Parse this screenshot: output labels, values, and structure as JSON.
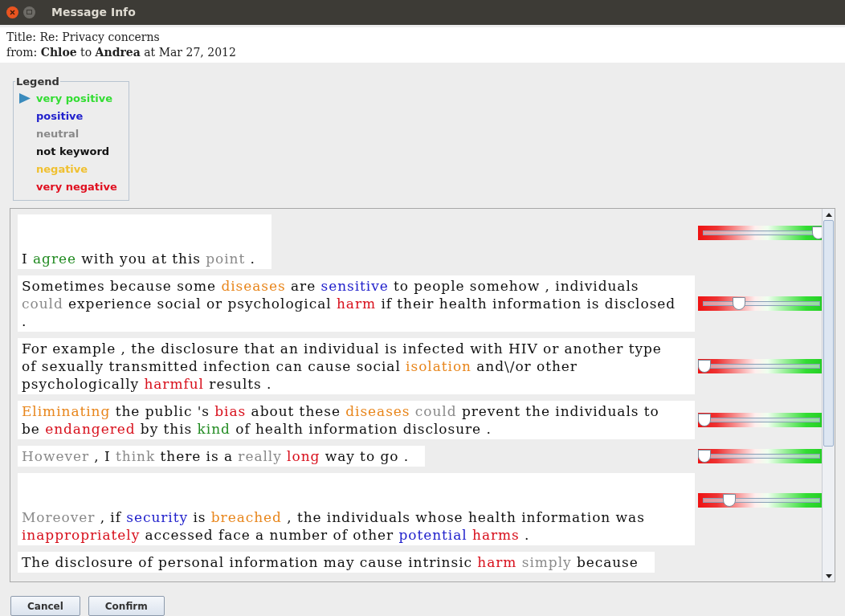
{
  "window": {
    "title": "Message Info"
  },
  "header": {
    "title_label": "Title:",
    "title": "Re: Privacy concerns",
    "from_label": "from:",
    "sender": "Chloe",
    "to_label": "to",
    "recipient": "Andrea",
    "at_label": "at",
    "date": "Mar 27, 2012"
  },
  "legend": {
    "title": "Legend",
    "items": [
      {
        "label": "very positive",
        "kind": "very_positive",
        "selected": true
      },
      {
        "label": "positive",
        "kind": "positive",
        "selected": false
      },
      {
        "label": "neutral",
        "kind": "neutral",
        "selected": false
      },
      {
        "label": "not keyword",
        "kind": "none",
        "selected": false
      },
      {
        "label": "negative",
        "kind": "negative",
        "selected": false
      },
      {
        "label": "very negative",
        "kind": "very_negative",
        "selected": false
      }
    ]
  },
  "sentences": [
    {
      "blank_line": true,
      "level": 1,
      "words": [
        {
          "text": "I",
          "kind": "none"
        },
        {
          "text": "agree",
          "kind": "very_positive"
        },
        {
          "text": "with you at this",
          "kind": "none"
        },
        {
          "text": "point",
          "kind": "neutral"
        },
        {
          "text": ".",
          "kind": "none"
        }
      ]
    },
    {
      "blank_line": false,
      "level": 0.3,
      "words": [
        {
          "text": "Sometimes because some",
          "kind": "none"
        },
        {
          "text": "diseases",
          "kind": "negative"
        },
        {
          "text": "are",
          "kind": "none"
        },
        {
          "text": "sensitive",
          "kind": "positive"
        },
        {
          "text": "to people somehow , individuals",
          "kind": "none"
        },
        {
          "text": "could",
          "kind": "neutral"
        },
        {
          "text": "experience social or psychological",
          "kind": "none"
        },
        {
          "text": "harm",
          "kind": "very_negative"
        },
        {
          "text": "if their health information is disclosed .",
          "kind": "none"
        }
      ]
    },
    {
      "blank_line": false,
      "level": 0,
      "words": [
        {
          "text": "For example , the disclosure that an individual is infected with HIV or another type of sexually transmitted infection can cause social",
          "kind": "none"
        },
        {
          "text": "isolation",
          "kind": "negative"
        },
        {
          "text": "and\\/or other psychologically",
          "kind": "none"
        },
        {
          "text": "harmful",
          "kind": "very_negative"
        },
        {
          "text": "results .",
          "kind": "none"
        }
      ]
    },
    {
      "blank_line": false,
      "level": 0,
      "words": [
        {
          "text": "Eliminating",
          "kind": "negative"
        },
        {
          "text": "the public 's",
          "kind": "none"
        },
        {
          "text": "bias",
          "kind": "very_negative"
        },
        {
          "text": "about these",
          "kind": "none"
        },
        {
          "text": "diseases",
          "kind": "negative"
        },
        {
          "text": "could",
          "kind": "neutral"
        },
        {
          "text": "prevent the individuals to be",
          "kind": "none"
        },
        {
          "text": "endangered",
          "kind": "very_negative"
        },
        {
          "text": "by this",
          "kind": "none"
        },
        {
          "text": "kind",
          "kind": "very_positive"
        },
        {
          "text": "of health information disclosure .",
          "kind": "none"
        }
      ]
    },
    {
      "blank_line": false,
      "level": 0,
      "words": [
        {
          "text": "However",
          "kind": "neutral"
        },
        {
          "text": ", I",
          "kind": "none"
        },
        {
          "text": "think",
          "kind": "neutral"
        },
        {
          "text": "there is a",
          "kind": "none"
        },
        {
          "text": "really",
          "kind": "neutral"
        },
        {
          "text": "long",
          "kind": "very_negative"
        },
        {
          "text": "way to go .",
          "kind": "none"
        }
      ]
    },
    {
      "blank_line": true,
      "level": 0.22,
      "words": [
        {
          "text": "Moreover",
          "kind": "neutral"
        },
        {
          "text": ", if",
          "kind": "none"
        },
        {
          "text": "security",
          "kind": "positive"
        },
        {
          "text": "is",
          "kind": "none"
        },
        {
          "text": "breached",
          "kind": "negative"
        },
        {
          "text": ", the individuals whose health information was",
          "kind": "none"
        },
        {
          "text": "inappropriately",
          "kind": "very_negative"
        },
        {
          "text": "accessed face a number of other",
          "kind": "none"
        },
        {
          "text": "potential",
          "kind": "positive"
        },
        {
          "text": "harms",
          "kind": "very_negative"
        },
        {
          "text": ".",
          "kind": "none"
        }
      ]
    },
    {
      "blank_line": false,
      "words": [
        {
          "text": "The disclosure of personal information may cause intrinsic",
          "kind": "none"
        },
        {
          "text": "harm",
          "kind": "very_negative"
        },
        {
          "text": "simply",
          "kind": "neutral"
        },
        {
          "text": "because",
          "kind": "none"
        }
      ]
    }
  ],
  "buttons": [
    "Cancel",
    "Confirm"
  ]
}
